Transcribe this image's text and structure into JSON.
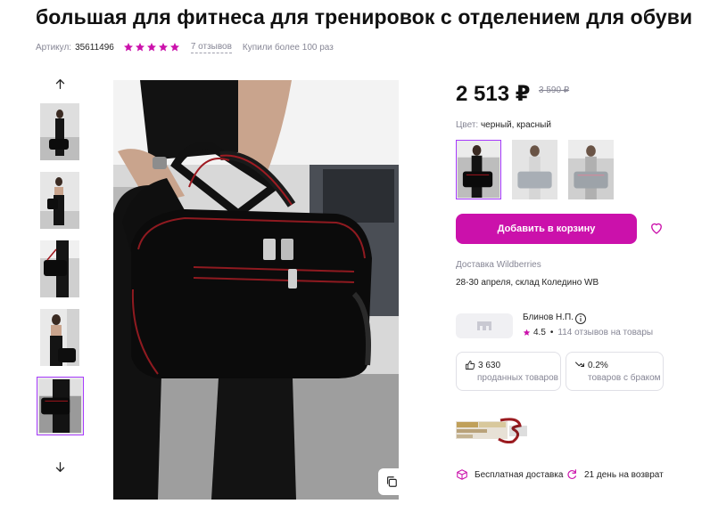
{
  "product": {
    "title": "большая для фитнеса для тренировок с отделением для обуви",
    "article_label": "Артикул:",
    "article_number": "35611496",
    "rating_stars": 5,
    "reviews_link": "7 отзывов",
    "bought_text": "Купили более 100 раз"
  },
  "gallery": {
    "thumbnails_count": 5,
    "active_index": 4,
    "up_icon": "arrow-up-icon",
    "down_icon": "arrow-down-icon",
    "copy_icon": "copy-icon"
  },
  "pricing": {
    "price": "2 513 ₽",
    "old_price": "3 590 ₽"
  },
  "color": {
    "label": "Цвет:",
    "value": "черный, красный"
  },
  "actions": {
    "add_to_cart": "Добавить в корзину",
    "favorite_icon": "heart-icon"
  },
  "delivery": {
    "label": "Доставка Wildberries",
    "value": "28-30 апреля, склад Коледино WB"
  },
  "seller": {
    "name": "Блинов Н.П.",
    "rating": "4.5",
    "reviews": "114 отзывов на товары"
  },
  "stats": {
    "sold_count": "3 630",
    "sold_label": "проданных товаров",
    "defect_rate": "0.2%",
    "defect_label": "товаров с браком"
  },
  "perks": {
    "free_delivery": "Бесплатная доставка",
    "return_policy": "21 день на возврат"
  },
  "colors": {
    "accent": "#cb11ab",
    "star": "#cb11ab",
    "active_border": "#a73afd",
    "muted_text": "#868695"
  }
}
